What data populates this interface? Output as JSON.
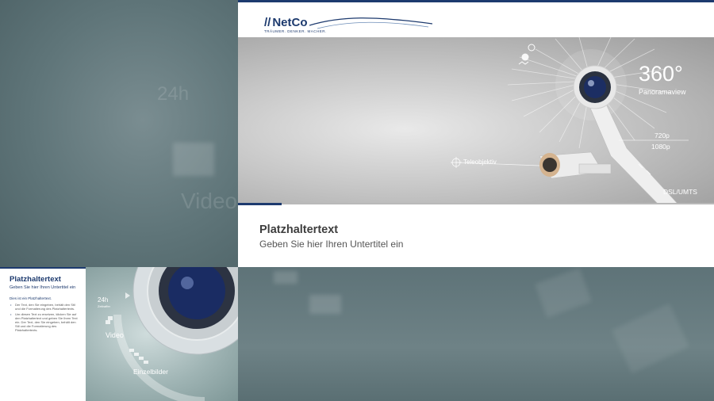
{
  "background": {
    "ghost_24h": "24h",
    "ghost_video": "Video"
  },
  "slide": {
    "logo_name": "NetCo",
    "logo_tagline": "TRÄUMER. DENKER. MACHER.",
    "title": "Platzhaltertext",
    "subtitle": "Geben Sie hier Ihren Untertitel ein",
    "hero": {
      "deg": "360°",
      "panorama": "Panoramaview",
      "res1": "720p",
      "res2": "1080p",
      "tele": "Teleobjektiv",
      "dsl": "DSL/UMTS"
    }
  },
  "mini": {
    "title": "Platzhaltertext",
    "subtitle": "Geben Sie hier Ihren Untertitel ein",
    "heading": "Dies ist ein Platzhaltertext.",
    "bullets": [
      "Der Text, den Sie eingeben, behält den Stil und die Formatierung des Platzhaltertexts.",
      "Um diesen Text zu ersetzen, klicken Sie auf den Platzhaltertext und geben Sie Ihren Text ein. Der Text, den Sie eingeben, behält den Stil und die Formatierung des Platzhaltertexts."
    ],
    "label_24h": "24h",
    "label_24h_sub": "Zeitraffer",
    "label_video": "Video",
    "label_frames": "Einzelbilder"
  },
  "colors": {
    "brand": "#1d3a6e",
    "background": "#5f7479"
  }
}
